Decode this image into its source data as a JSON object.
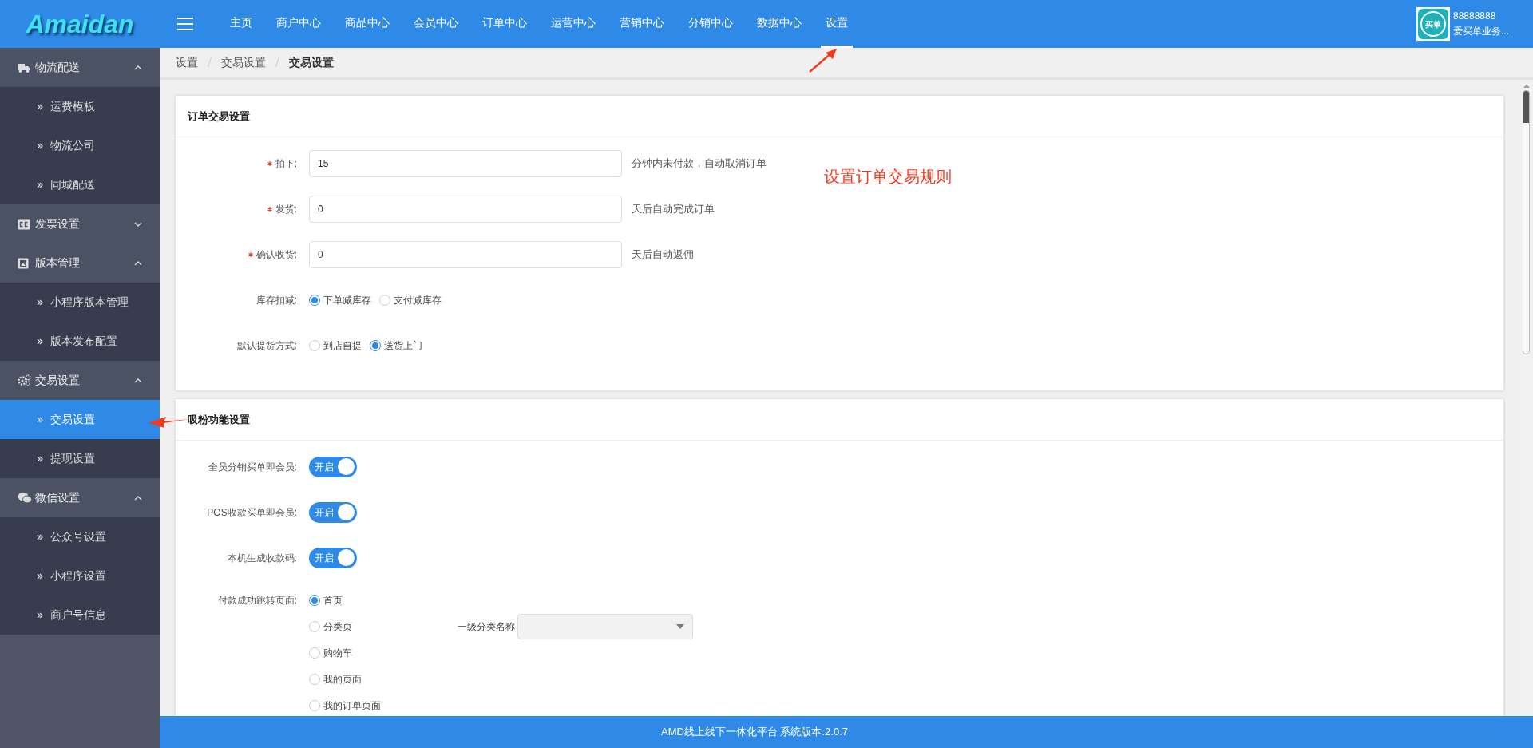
{
  "header": {
    "logo": "Amaidan",
    "nav": [
      {
        "label": "主页",
        "selected": false
      },
      {
        "label": "商户中心",
        "selected": false
      },
      {
        "label": "商品中心",
        "selected": false
      },
      {
        "label": "会员中心",
        "selected": false
      },
      {
        "label": "订单中心",
        "selected": false
      },
      {
        "label": "运营中心",
        "selected": false
      },
      {
        "label": "营销中心",
        "selected": false
      },
      {
        "label": "分销中心",
        "selected": false
      },
      {
        "label": "数据中心",
        "selected": false
      },
      {
        "label": "设置",
        "selected": true
      }
    ],
    "user": {
      "avatar_text": "买单",
      "id": "88888888",
      "name": "爱买单业务..."
    }
  },
  "sidebar": {
    "groups": [
      {
        "label": "物流配送",
        "expanded": true,
        "children": [
          {
            "label": "运费模板",
            "selected": false
          },
          {
            "label": "物流公司",
            "selected": false
          },
          {
            "label": "同城配送",
            "selected": false
          }
        ]
      },
      {
        "label": "发票设置",
        "expanded": false
      },
      {
        "label": "版本管理",
        "expanded": true,
        "children": [
          {
            "label": "小程序版本管理",
            "selected": false
          },
          {
            "label": "版本发布配置",
            "selected": false
          }
        ]
      },
      {
        "label": "交易设置",
        "expanded": true,
        "children": [
          {
            "label": "交易设置",
            "selected": true
          },
          {
            "label": "提现设置",
            "selected": false
          }
        ]
      },
      {
        "label": "微信设置",
        "expanded": true,
        "children": [
          {
            "label": "公众号设置",
            "selected": false
          },
          {
            "label": "小程序设置",
            "selected": false
          },
          {
            "label": "商户号信息",
            "selected": false
          }
        ]
      }
    ]
  },
  "breadcrumb": [
    "设置",
    "交易设置",
    "交易设置"
  ],
  "cards": [
    {
      "title": "订单交易设置",
      "rows": [
        {
          "kind": "input",
          "required": true,
          "label": "拍下:",
          "value": "15",
          "hint": "分钟内未付款，自动取消订单"
        },
        {
          "kind": "input",
          "required": true,
          "label": "发货:",
          "value": "0",
          "hint": "天后自动完成订单"
        },
        {
          "kind": "input",
          "required": true,
          "label": "确认收货:",
          "value": "0",
          "hint": "天后自动返佣"
        },
        {
          "kind": "radio",
          "label": "库存扣减:",
          "options": [
            {
              "label": "下单减库存",
              "selected": true
            },
            {
              "label": "支付减库存",
              "selected": false
            }
          ]
        },
        {
          "kind": "radio",
          "label": "默认提货方式:",
          "options": [
            {
              "label": "到店自提",
              "selected": false
            },
            {
              "label": "送货上门",
              "selected": true
            }
          ]
        }
      ]
    },
    {
      "title": "吸粉功能设置",
      "rows": [
        {
          "kind": "toggle",
          "label": "全员分销买单即会员:",
          "on": true,
          "text": "开启"
        },
        {
          "kind": "toggle",
          "label": "POS收款买单即会员:",
          "on": true,
          "text": "开启"
        },
        {
          "kind": "toggle",
          "label": "本机生成收款码:",
          "on": true,
          "text": "开启"
        },
        {
          "kind": "radio_list",
          "label": "付款成功跳转页面:",
          "options": [
            {
              "label": "首页",
              "selected": true
            },
            {
              "label": "分类页",
              "selected": false,
              "select_label": "一级分类名称"
            },
            {
              "label": "购物车",
              "selected": false
            },
            {
              "label": "我的页面",
              "selected": false
            },
            {
              "label": "我的订单页面",
              "selected": false
            }
          ]
        }
      ]
    }
  ],
  "annotations": [
    {
      "text": "设置订单交易规则"
    }
  ],
  "footer": "AMD线上线下一体化平台 系统版本:2.0.7"
}
